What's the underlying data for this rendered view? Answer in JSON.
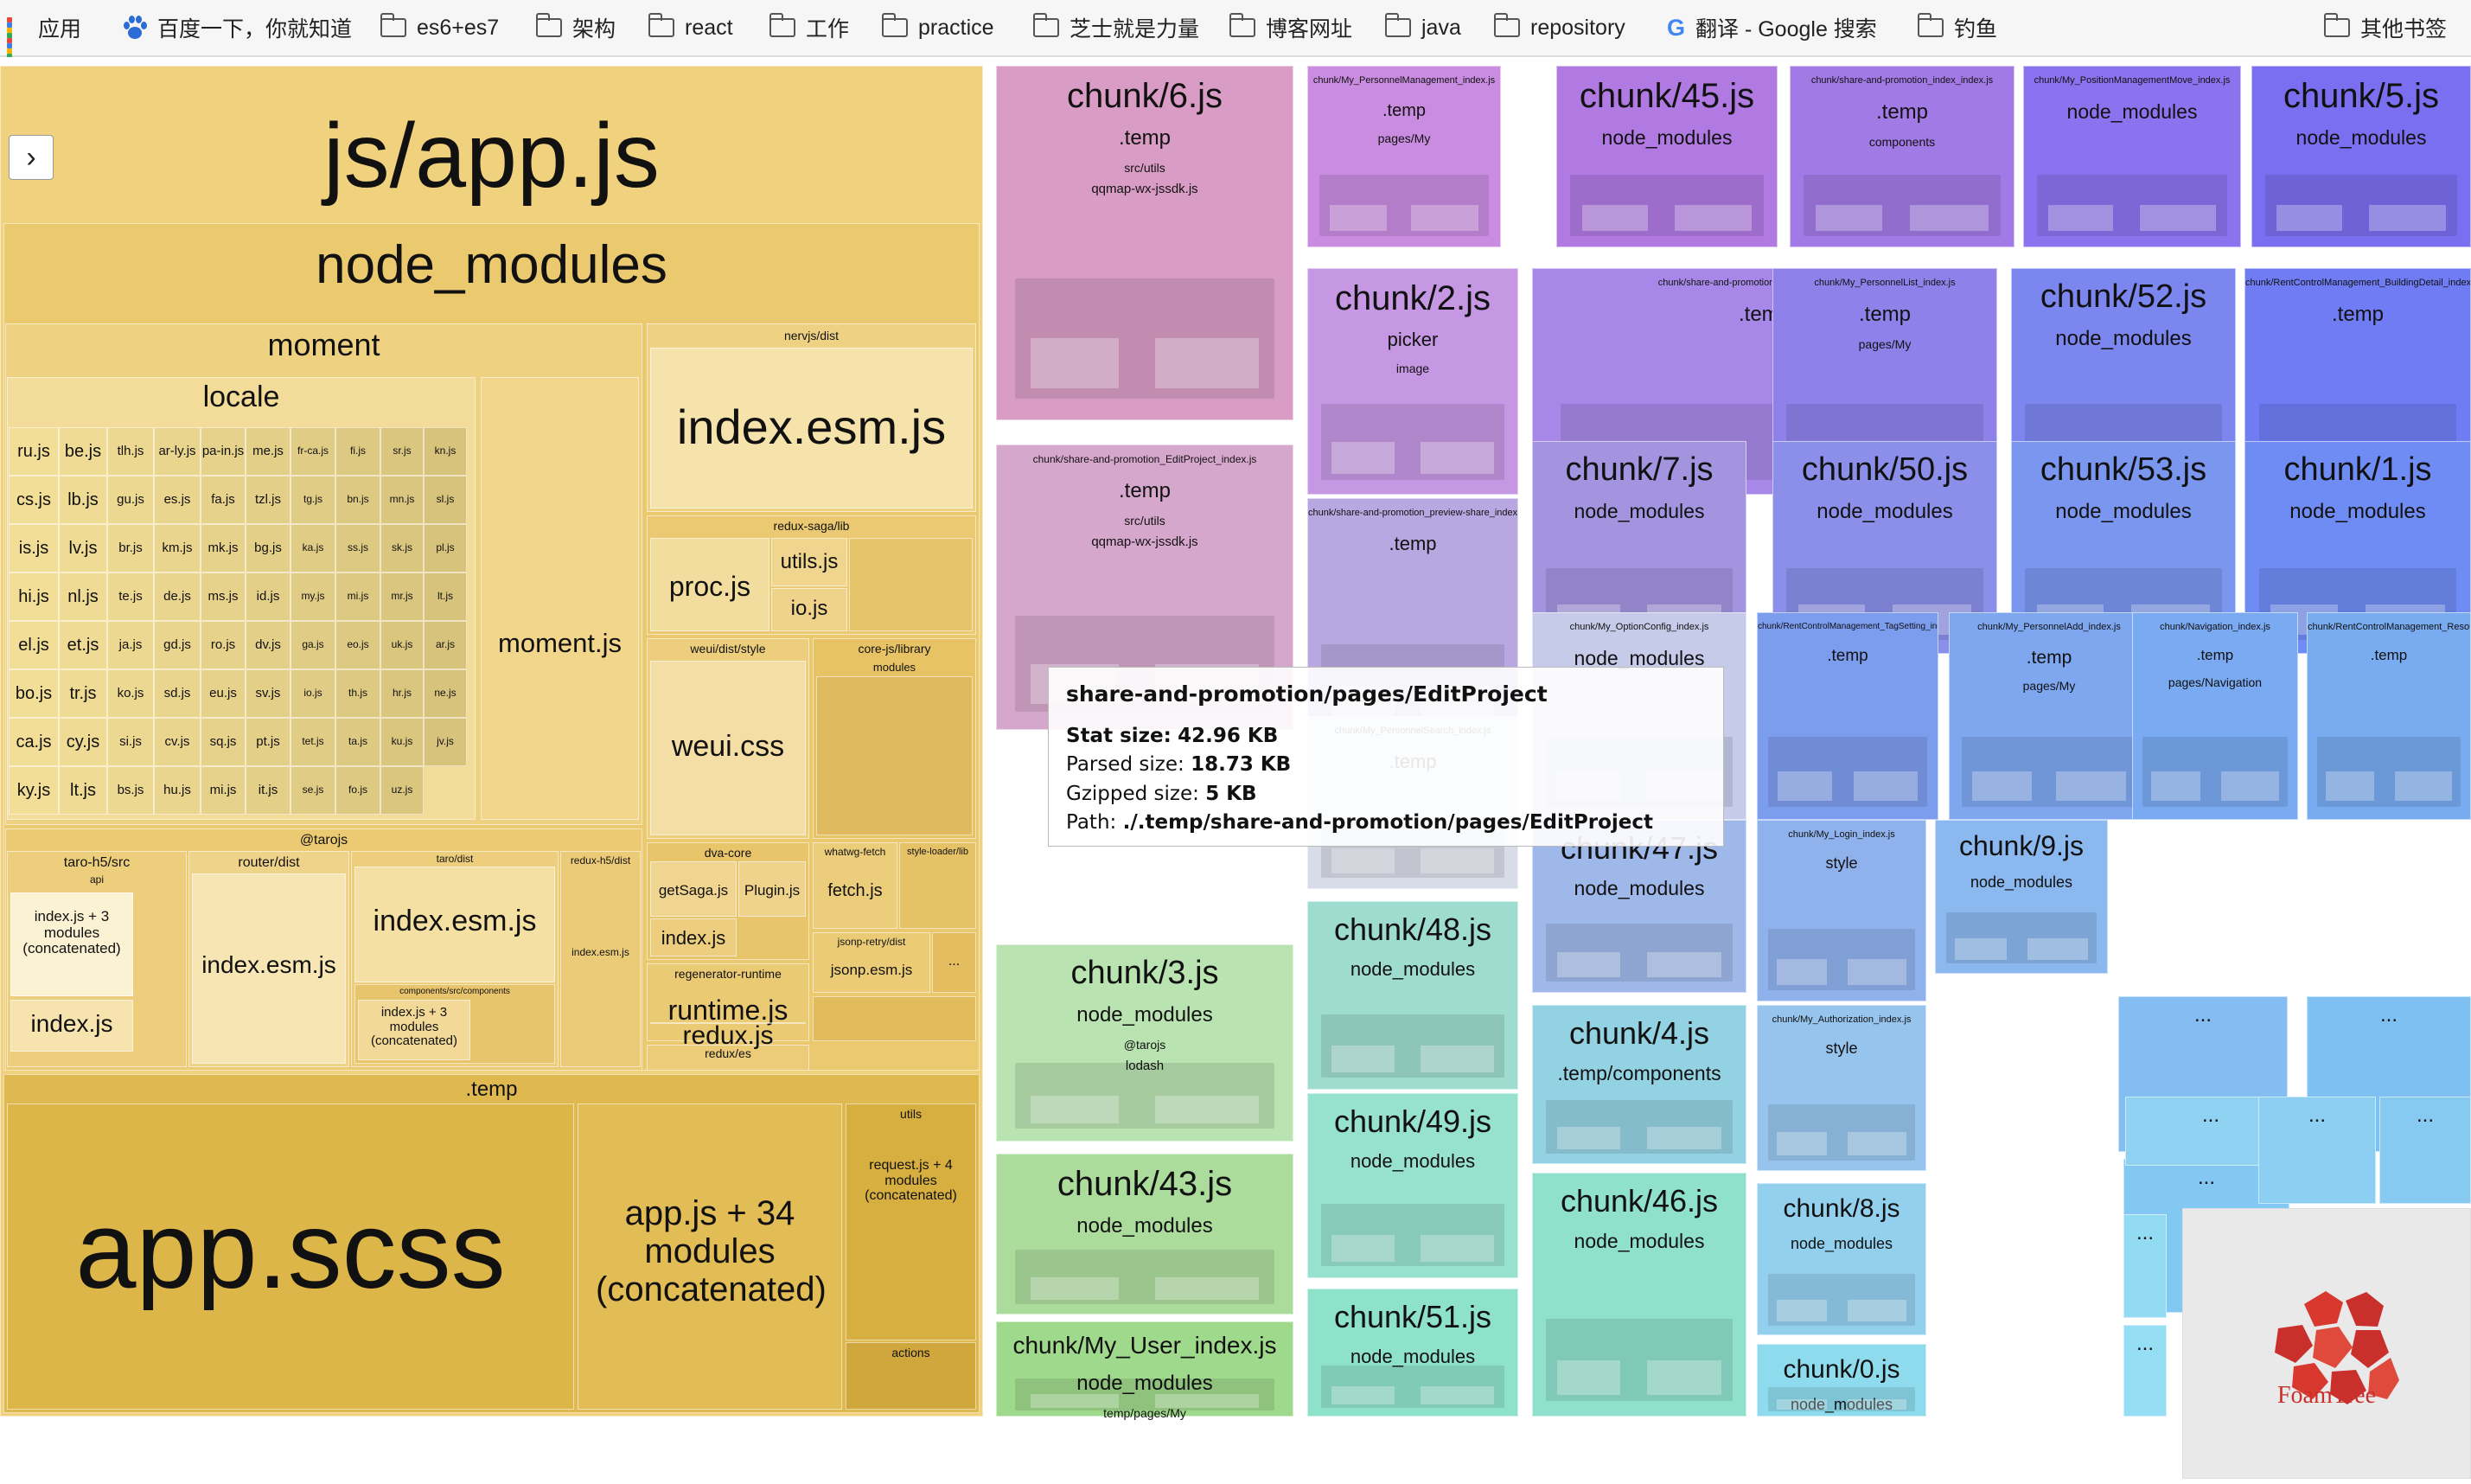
{
  "bookmarks_bar": {
    "items": [
      {
        "label": "应用",
        "icon": "apps-grid-icon"
      },
      {
        "label": "百度一下，你就知道",
        "icon": "baidu-paw-icon"
      },
      {
        "label": "es6+es7",
        "icon": "folder-icon"
      },
      {
        "label": "架构",
        "icon": "folder-icon"
      },
      {
        "label": "react",
        "icon": "folder-icon"
      },
      {
        "label": "工作",
        "icon": "folder-icon"
      },
      {
        "label": "practice",
        "icon": "folder-icon"
      },
      {
        "label": "芝士就是力量",
        "icon": "folder-icon"
      },
      {
        "label": "博客网址",
        "icon": "folder-icon"
      },
      {
        "label": "java",
        "icon": "folder-icon"
      },
      {
        "label": "repository",
        "icon": "folder-icon"
      },
      {
        "label": "翻译 - Google 搜索",
        "icon": "google-icon"
      },
      {
        "label": "钓鱼",
        "icon": "folder-icon"
      },
      {
        "label": "其他书签",
        "icon": "folder-icon"
      }
    ]
  },
  "sidebar_toggle": {
    "label": "›"
  },
  "colors": {
    "app_main": "#f0cf78",
    "app_node_modules": "#e9c76a",
    "app_temp": "#ddb64b",
    "pink": "#d99cc4",
    "violet": "#b07ae2",
    "purple_blue": "#8b73ef",
    "blue": "#6b87f2",
    "sky": "#7fb2f1",
    "cyan": "#8edbe9",
    "mint": "#95e3c2",
    "green": "#a9dc99",
    "tooltip_bg": "#ffffff",
    "foamtree_red": "#c9302c"
  },
  "treemap": {
    "app": {
      "name": "js/app.js",
      "node_modules": "node_modules",
      "moment": "moment",
      "locale": "locale",
      "moment_js": "moment.js",
      "locale_files": [
        "ru.js",
        "be.js",
        "tlh.js",
        "ar-ly.js",
        "pa-in.js",
        "me.js",
        "fr-ca.js",
        "fi.js",
        "sr.js",
        "kn.js",
        "cs.js",
        "lb.js",
        "gu.js",
        "es.js",
        "fa.js",
        "tzl.js",
        "tg.js",
        "bn.js",
        "mn.js",
        "sl.js",
        "is.js",
        "lv.js",
        "br.js",
        "km.js",
        "mk.js",
        "bg.js",
        "ka.js",
        "ss.js",
        "sk.js",
        "pl.js",
        "hi.js",
        "nl.js",
        "te.js",
        "de.js",
        "ms.js",
        "id.js",
        "my.js",
        "mi.js",
        "mr.js",
        "lt.js",
        "el.js",
        "et.js",
        "ja.js",
        "gd.js",
        "ro.js",
        "dv.js",
        "ga.js",
        "eo.js",
        "uk.js",
        "ar.js",
        "bo.js",
        "tr.js",
        "ko.js",
        "sd.js",
        "eu.js",
        "sv.js",
        "io.js",
        "th.js",
        "hr.js",
        "ne.js",
        "ca.js",
        "cy.js",
        "si.js",
        "cv.js",
        "sq.js",
        "pt.js",
        "tet.js",
        "ta.js",
        "ku.js",
        "jv.js",
        "ky.js",
        "lt.js",
        "bs.js",
        "hu.js",
        "mi.js",
        "it.js",
        "se.js",
        "fo.js",
        "uz.js"
      ],
      "nervjs": "nervjs/dist",
      "nervjs_index": "index.esm.js",
      "redux_saga": "redux-saga/lib",
      "proc": "proc.js",
      "utils": "utils.js",
      "io": "io.js",
      "weui_dist": "weui/dist/style",
      "weui_css": "weui.css",
      "core_js": "core-js/library",
      "modules": "modules",
      "dva_core": "dva-core",
      "getsaga": "getSaga.js",
      "plugin": "Plugin.js",
      "dva_index": "index.js",
      "whatwg": "whatwg-fetch",
      "fetch": "fetch.js",
      "style_loader": "style-loader/lib",
      "jsonp_retry": "jsonp-retry/dist",
      "jsonp": "jsonp.esm.js",
      "regenerator": "regenerator-runtime",
      "runtime": "runtime.js",
      "redux_es": "redux/es",
      "redux": "redux.js",
      "tarojs": "@tarojs",
      "taro_h5": "taro-h5/src",
      "api": "api",
      "taro_h5_concat": "index.js + 3 modules (concatenated)",
      "taro_h5_index": "index.js",
      "router": "router/dist",
      "router_index": "index.esm.js",
      "taro_dist": "taro/dist",
      "taro_index": "index.esm.js",
      "components_src": "components/src/components",
      "components_concat": "index.js + 3 modules (concatenated)",
      "redux_h5": "redux-h5/dist",
      "redux_h5_index": "index.esm.js",
      "temp": ".temp",
      "app_scss": "app.scss",
      "app_concat": "app.js + 34 modules (concatenated)",
      "temp_utils": "utils",
      "request_concat": "request.js + 4 modules (concatenated)",
      "actions": "actions"
    },
    "chunks": [
      {
        "name": "chunk/6.js",
        "sub": ".temp",
        "extra": "src/utils",
        "extra2": "qqmap-wx-jssdk.js"
      },
      {
        "name": "chunk/My_PersonnelManagement_index.js",
        "sub": ".temp",
        "extra": "pages/My"
      },
      {
        "name": "chunk/45.js",
        "sub": "node_modules"
      },
      {
        "name": "chunk/share-and-promotion_index_index.js",
        "sub": ".temp",
        "extra": "components"
      },
      {
        "name": "chunk/My_PositionManagementMove_index.js",
        "sub": "node_modules"
      },
      {
        "name": "chunk/5.js",
        "sub": "node_modules"
      },
      {
        "name": "chunk/2.js",
        "sub": "picker",
        "extra": "image"
      },
      {
        "name": "chunk/share-and-promotion_CreateShare_index.js",
        "sub": ".temp"
      },
      {
        "name": "chunk/My_PersonnelList_index.js",
        "sub": ".temp",
        "extra": "pages/My"
      },
      {
        "name": "chunk/52.js",
        "sub": "node_modules"
      },
      {
        "name": "chunk/RentControlManagement_BuildingDetail_index.js",
        "sub": ".temp"
      },
      {
        "name": "chunk/share-and-promotion_EditProject_index.js",
        "sub": ".temp",
        "extra": "src/utils",
        "extra2": "qqmap-wx-jssdk.js"
      },
      {
        "name": "chunk/share-and-promotion_preview-share_index.js",
        "sub": ".temp"
      },
      {
        "name": "chunk/7.js",
        "sub": "node_modules"
      },
      {
        "name": "chunk/50.js",
        "sub": "node_modules"
      },
      {
        "name": "chunk/53.js",
        "sub": "node_modules"
      },
      {
        "name": "chunk/1.js",
        "sub": "node_modules"
      },
      {
        "name": "chunk/My_OptionConfig_index.js",
        "sub": "node_modules"
      },
      {
        "name": "chunk/RentControlManagement_TagSetting_index.js",
        "sub": ".temp"
      },
      {
        "name": "chunk/My_PersonnelAdd_index.js",
        "sub": ".temp",
        "extra": "pages/My"
      },
      {
        "name": "chunk/Navigation_index.js",
        "sub": ".temp",
        "extra": "pages/Navigation"
      },
      {
        "name": "chunk/RentControlManagement_ResourceDetail_index.js",
        "sub": ".temp"
      },
      {
        "name": "chunk/My_PersonnelSearch_index.js",
        "sub": ".temp"
      },
      {
        "name": "chunk/47.js",
        "sub": "node_modules"
      },
      {
        "name": "chunk/My_Login_index.js",
        "sub": "style"
      },
      {
        "name": "chunk/9.js",
        "sub": "node_modules"
      },
      {
        "name": "chunk/48.js",
        "sub": "node_modules"
      },
      {
        "name": "chunk/3.js",
        "sub": "node_modules",
        "extra": "@tarojs",
        "extra2": "lodash"
      },
      {
        "name": "chunk/4.js",
        "sub": ".temp/components"
      },
      {
        "name": "chunk/My_Authorization_index.js",
        "sub": "style"
      },
      {
        "name": "chunk/49.js",
        "sub": "node_modules"
      },
      {
        "name": "chunk/43.js",
        "sub": "node_modules"
      },
      {
        "name": "chunk/8.js",
        "sub": "node_modules"
      },
      {
        "name": "chunk/51.js",
        "sub": "node_modules"
      },
      {
        "name": "chunk/My_User_index.js",
        "sub": "node_modules",
        "extra": "temp/pages/My"
      },
      {
        "name": "chunk/46.js",
        "sub": "node_modules"
      },
      {
        "name": "chunk/0.js",
        "sub": "node_modules"
      }
    ],
    "ellipsis": "...",
    "temp_only": ".temp"
  },
  "tooltip": {
    "title": "share-and-promotion/pages/EditProject",
    "stat_label": "Stat size:",
    "stat_value": "42.96 KB",
    "parsed_label": "Parsed size:",
    "parsed_value": "18.73 KB",
    "gzip_label": "Gzipped size:",
    "gzip_value": "5 KB",
    "path_label": "Path:",
    "path_value": "./.temp/share-and-promotion/pages/EditProject"
  },
  "brand": {
    "name": "FoamTree"
  }
}
